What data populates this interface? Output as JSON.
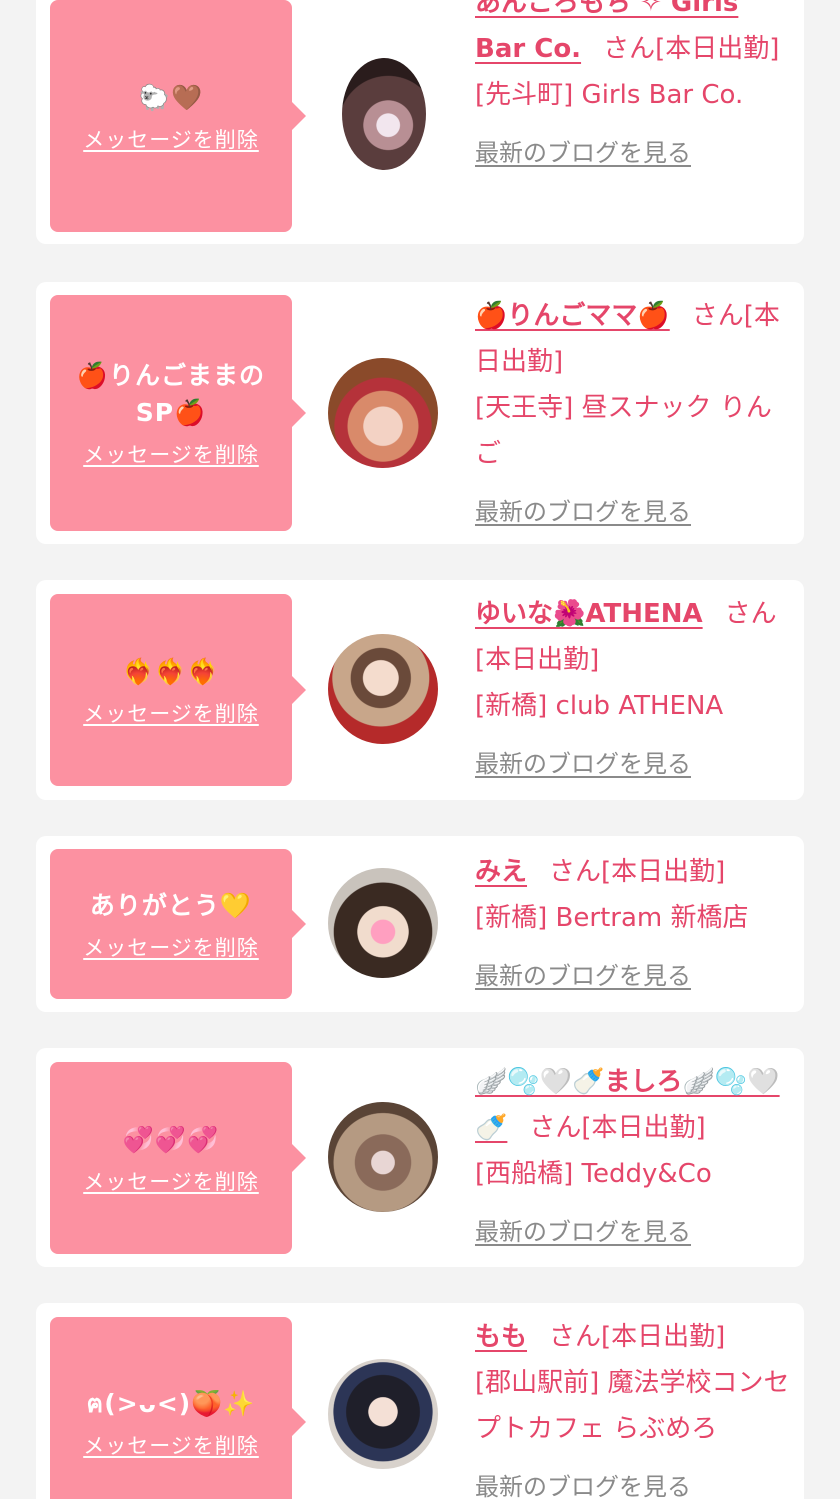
{
  "entries": [
    {
      "message": "🐑🤎",
      "delete_label": "メッセージを削除",
      "name": "あんころもち ✧ Girls Bar Co.",
      "suffix": "さん[本日出勤]",
      "shop": "[先斗町] Girls Bar Co.",
      "blog_label": "最新のブログを見る"
    },
    {
      "message": "🍎りんごままのSP🍎",
      "delete_label": "メッセージを削除",
      "name": "🍎りんごママ🍎",
      "suffix": "さん[本日出勤]",
      "shop": "[天王寺] 昼スナック りんご",
      "blog_label": "最新のブログを見る"
    },
    {
      "message": "❤️‍🔥❤️‍🔥❤️‍🔥",
      "delete_label": "メッセージを削除",
      "name": "ゆいな🌺ATHENA",
      "suffix": "さん[本日出勤]",
      "shop": "[新橋] club ATHENA",
      "blog_label": "最新のブログを見る"
    },
    {
      "message": "ありがとう💛",
      "delete_label": "メッセージを削除",
      "name": "みえ",
      "suffix": "さん[本日出勤]",
      "shop": "[新橋] Bertram 新橋店",
      "blog_label": "最新のブログを見る"
    },
    {
      "message": "💞💞💞",
      "delete_label": "メッセージを削除",
      "name": "🪽🫧🤍🍼ましろ🪽🫧🤍🍼",
      "suffix": "さん[本日出勤]",
      "shop": "[西船橋] Teddy&Co",
      "blog_label": "最新のブログを見る"
    },
    {
      "message": "ฅ(>ᴗ<)🍑✨",
      "delete_label": "メッセージを削除",
      "name": "もも",
      "suffix": "さん[本日出勤]",
      "shop": "[郡山駅前] 魔法学校コンセプトカフェ らぶめろ",
      "blog_label": "最新のブログを見る"
    }
  ],
  "colors": {
    "bubble": "#fc91a1",
    "accent": "#e5466a",
    "link_gray": "#8a8a8a",
    "page_bg": "#f3f3f3"
  }
}
